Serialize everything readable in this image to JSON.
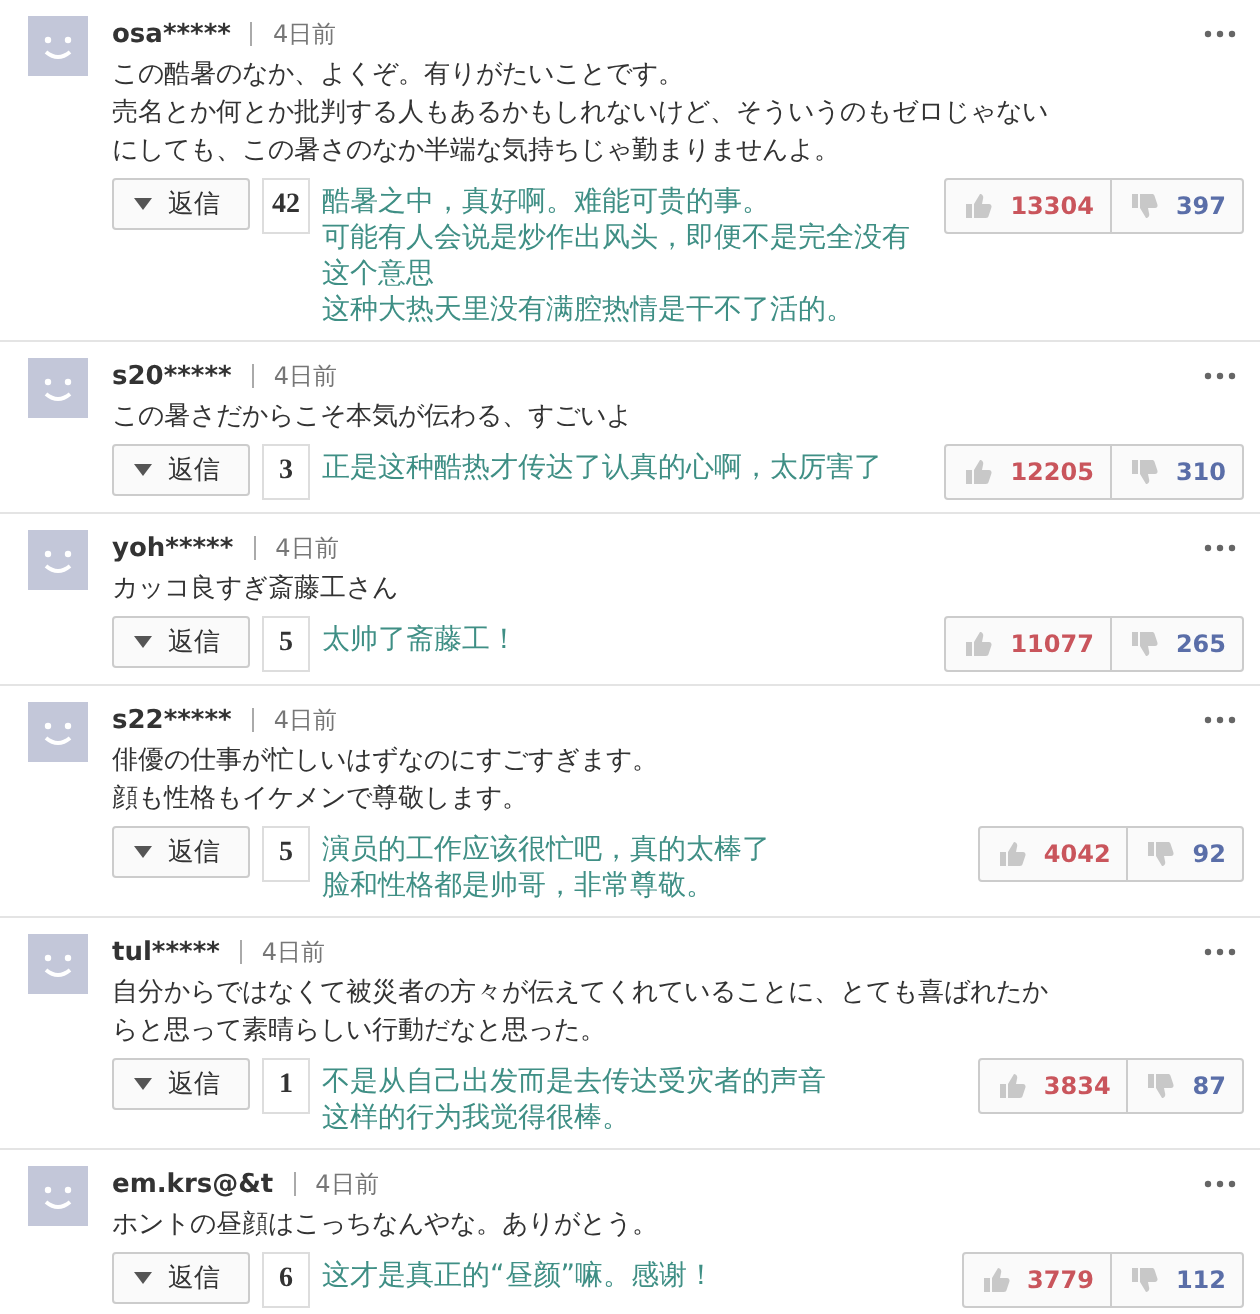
{
  "comments": [
    {
      "user": "osa*****",
      "time": "4日前",
      "lines": [
        "この酷暑のなか、よくぞ。有りがたいことです。",
        "売名とか何とか批判する人もあるかもしれないけど、そういうのもゼロじゃない",
        "にしても、この暑さのなか半端な気持ちじゃ勤まりませんよ。"
      ],
      "reply_label": "返信",
      "reply_count": "42",
      "translation": [
        "酷暑之中，真好啊。难能可贵的事。",
        "可能有人会说是炒作出风头，即便不是完全没有这个意思",
        "这种大热天里没有满腔热情是干不了活的。"
      ],
      "likes": "13304",
      "dislikes": "397"
    },
    {
      "user": "s20*****",
      "time": "4日前",
      "lines": [
        "この暑さだからこそ本気が伝わる、すごいよ"
      ],
      "reply_label": "返信",
      "reply_count": "3",
      "translation": [
        "正是这种酷热才传达了认真的心啊，太厉害了"
      ],
      "likes": "12205",
      "dislikes": "310"
    },
    {
      "user": "yoh*****",
      "time": "4日前",
      "lines": [
        "カッコ良すぎ斎藤工さん"
      ],
      "reply_label": "返信",
      "reply_count": "5",
      "translation": [
        "太帅了斋藤工！"
      ],
      "likes": "11077",
      "dislikes": "265"
    },
    {
      "user": "s22*****",
      "time": "4日前",
      "lines": [
        "俳優の仕事が忙しいはずなのにすごすぎます。",
        "顔も性格もイケメンで尊敬します。"
      ],
      "reply_label": "返信",
      "reply_count": "5",
      "translation": [
        "演员的工作应该很忙吧，真的太棒了",
        "脸和性格都是帅哥，非常尊敬。"
      ],
      "likes": "4042",
      "dislikes": "92"
    },
    {
      "user": "tul*****",
      "time": "4日前",
      "lines": [
        "自分からではなくて被災者の方々が伝えてくれていることに、とても喜ばれたか",
        "らと思って素晴らしい行動だなと思った。"
      ],
      "reply_label": "返信",
      "reply_count": "1",
      "translation": [
        "不是从自己出发而是去传达受灾者的声音",
        "这样的行为我觉得很棒。"
      ],
      "likes": "3834",
      "dislikes": "87"
    },
    {
      "user": "em.krs@&t",
      "time": "4日前",
      "lines": [
        "ホントの昼顔はこっちなんやな。ありがとう。"
      ],
      "reply_label": "返信",
      "reply_count": "6",
      "translation": [
        "这才是真正的“昼颜”嘛。感谢！"
      ],
      "likes": "3779",
      "dislikes": "112"
    }
  ]
}
